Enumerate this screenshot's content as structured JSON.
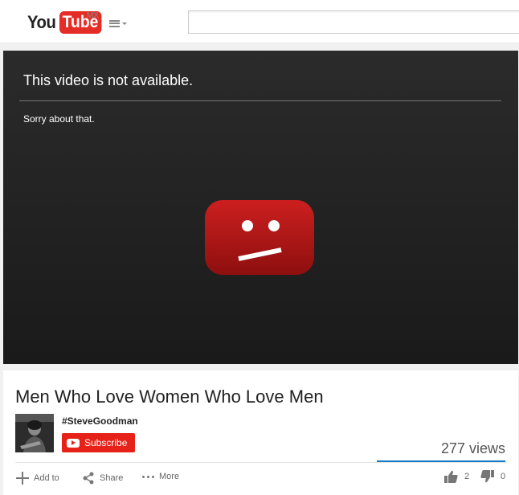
{
  "header": {
    "logo_you": "You",
    "logo_tube": "Tube",
    "region": "MX",
    "search_placeholder": ""
  },
  "player": {
    "error_title": "This video is not available.",
    "error_subtitle": "Sorry about that.",
    "error_icon": "sad-youtube-icon"
  },
  "video": {
    "title": "Men Who Love Women Who Love Men",
    "channel": "#SteveGoodman",
    "subscribe_label": "Subscribe",
    "views": "277 views",
    "actions": {
      "add_to": "Add to",
      "share": "Share",
      "more": "More"
    },
    "likes": "2",
    "dislikes": "0"
  },
  "colors": {
    "brand_red": "#e62117",
    "view_bar": "#167ac6"
  }
}
